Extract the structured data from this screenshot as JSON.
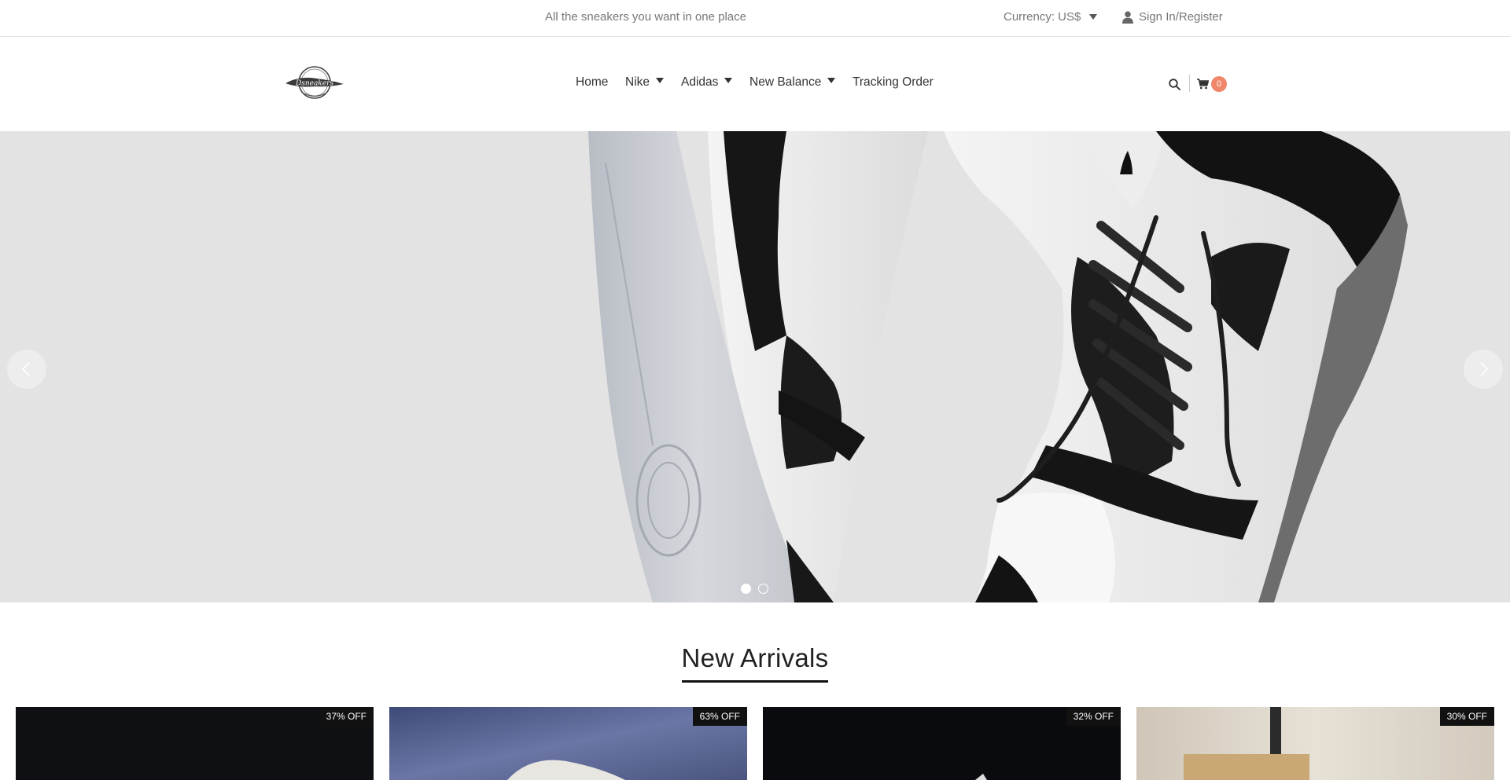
{
  "topbar": {
    "tagline": "All the sneakers you want in one place",
    "currency_label": "Currency: US$",
    "signin_label": "Sign In/Register"
  },
  "header": {
    "logo_text": "Dsneakers",
    "nav": [
      {
        "label": "Home",
        "has_dropdown": false
      },
      {
        "label": "Nike",
        "has_dropdown": true
      },
      {
        "label": "Adidas",
        "has_dropdown": true
      },
      {
        "label": "New Balance",
        "has_dropdown": true
      },
      {
        "label": "Tracking Order",
        "has_dropdown": false
      }
    ],
    "cart_count": "0",
    "icons": [
      "search-icon",
      "cart-icon",
      "user-icon"
    ]
  },
  "hero": {
    "slides_total": 2,
    "active_slide": 1
  },
  "new_arrivals": {
    "title": "New Arrivals",
    "products": [
      {
        "discount": "37% OFF"
      },
      {
        "discount": "63% OFF"
      },
      {
        "discount": "32% OFF"
      },
      {
        "discount": "30% OFF"
      }
    ]
  },
  "colors": {
    "accent_badge": "#f0876a",
    "text": "#333333",
    "muted": "#777777",
    "hero_bg": "#e3e3e3"
  }
}
